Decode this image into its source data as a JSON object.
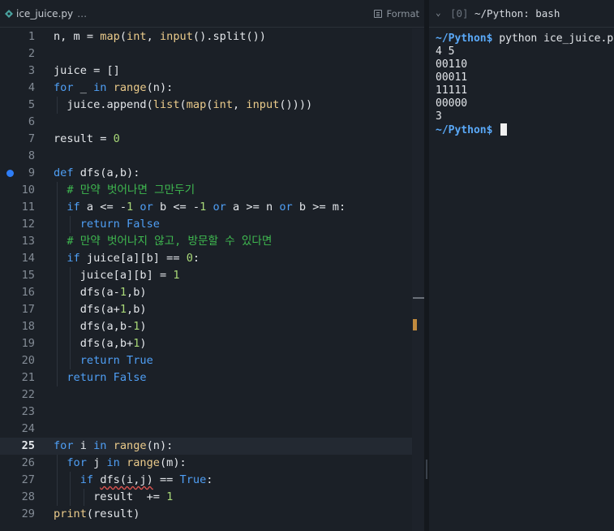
{
  "editor": {
    "file_name": "ice_juice.py",
    "breadcrumb_more": "…",
    "format_label": "Format",
    "breakpoint_line": 9,
    "current_line": 25,
    "lines": [
      {
        "n": "1",
        "t": "n, m = map(int, input().split())"
      },
      {
        "n": "2",
        "t": ""
      },
      {
        "n": "3",
        "t": "juice = []"
      },
      {
        "n": "4",
        "t": "for _ in range(n):"
      },
      {
        "n": "5",
        "t": "  juice.append(list(map(int, input())))"
      },
      {
        "n": "6",
        "t": ""
      },
      {
        "n": "7",
        "t": "result = 0"
      },
      {
        "n": "8",
        "t": ""
      },
      {
        "n": "9",
        "t": "def dfs(a,b):"
      },
      {
        "n": "10",
        "t": "  # 만약 벗어나면 그만두기"
      },
      {
        "n": "11",
        "t": "  if a <= -1 or b <= -1 or a >= n or b >= m:"
      },
      {
        "n": "12",
        "t": "    return False"
      },
      {
        "n": "13",
        "t": "  # 만약 벗어나지 않고, 방문할 수 있다면"
      },
      {
        "n": "14",
        "t": "  if juice[a][b] == 0:"
      },
      {
        "n": "15",
        "t": "    juice[a][b] = 1"
      },
      {
        "n": "16",
        "t": "    dfs(a-1,b)"
      },
      {
        "n": "17",
        "t": "    dfs(a+1,b)"
      },
      {
        "n": "18",
        "t": "    dfs(a,b-1)"
      },
      {
        "n": "19",
        "t": "    dfs(a,b+1)"
      },
      {
        "n": "20",
        "t": "    return True"
      },
      {
        "n": "21",
        "t": "  return False"
      },
      {
        "n": "22",
        "t": ""
      },
      {
        "n": "23",
        "t": ""
      },
      {
        "n": "24",
        "t": ""
      },
      {
        "n": "25",
        "t": "for i in range(n):"
      },
      {
        "n": "26",
        "t": "  for j in range(m):"
      },
      {
        "n": "27",
        "t": "    if dfs(i,j) == True:"
      },
      {
        "n": "28",
        "t": "      result  += 1"
      },
      {
        "n": "29",
        "t": "print(result)"
      }
    ]
  },
  "terminal": {
    "index": "[0]",
    "title": "~/Python: bash",
    "lines": [
      {
        "prompt": "~/Python$",
        "text": " python ice_juice.py"
      },
      {
        "prompt": "",
        "text": "4 5"
      },
      {
        "prompt": "",
        "text": "00110"
      },
      {
        "prompt": "",
        "text": "00011"
      },
      {
        "prompt": "",
        "text": "11111"
      },
      {
        "prompt": "",
        "text": "00000"
      },
      {
        "prompt": "",
        "text": "3"
      },
      {
        "prompt": "~/Python$",
        "text": " ",
        "cursor": true
      }
    ]
  },
  "icons": [
    "python-file-icon",
    "format-icon",
    "chevron-down-icon",
    "breakpoint-icon",
    "terminal-cursor"
  ]
}
